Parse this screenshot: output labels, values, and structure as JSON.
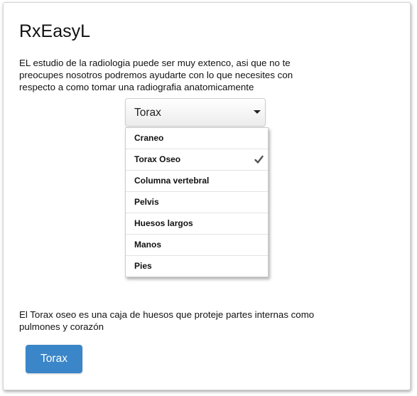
{
  "app": {
    "title": "RxEasyL",
    "intro": "EL estudio de la radiologia puede ser muy extenco, asi que no te preocupes nosotros podremos ayudarte con lo que necesites con respecto a como tomar una radiografia anatomicamente"
  },
  "select": {
    "value": "Torax",
    "icon": "chevron-down-icon",
    "options": [
      {
        "label": "Craneo",
        "selected": false
      },
      {
        "label": "Torax Oseo",
        "selected": true
      },
      {
        "label": "Columna vertebral",
        "selected": false
      },
      {
        "label": "Pelvis",
        "selected": false
      },
      {
        "label": "Huesos largos",
        "selected": false
      },
      {
        "label": "Manos",
        "selected": false
      },
      {
        "label": "Pies",
        "selected": false
      }
    ],
    "check_icon": "checkmark-icon"
  },
  "description": "El Torax oseo es una caja de huesos que proteje partes internas como pulmones y corazón",
  "button": {
    "label": "Torax"
  },
  "colors": {
    "button_bg": "#3a86c8",
    "text": "#111111",
    "check": "#555555"
  }
}
